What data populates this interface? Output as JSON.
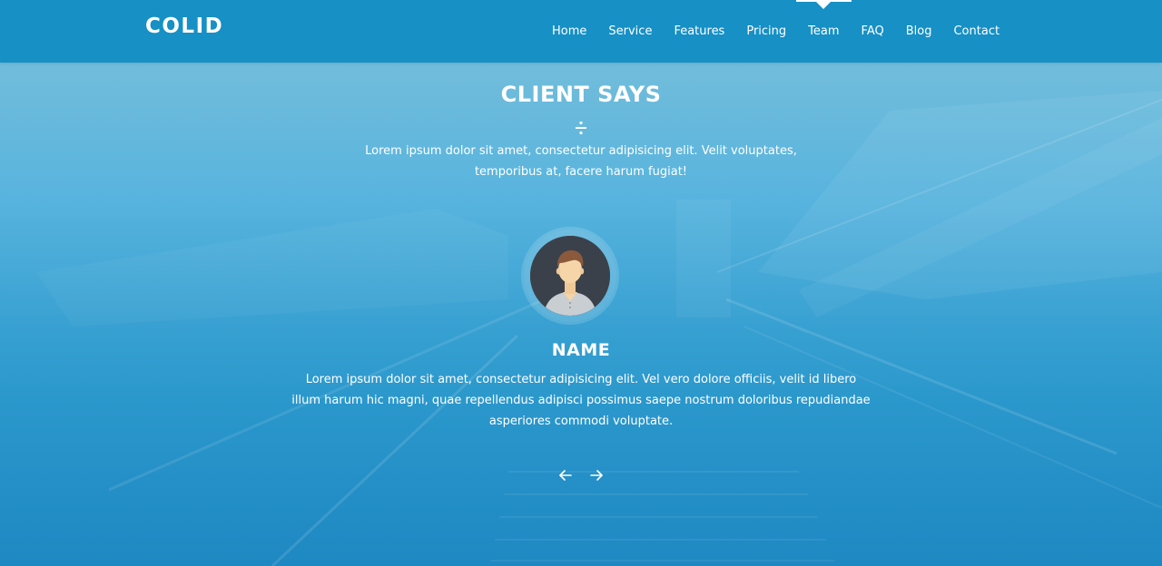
{
  "header": {
    "logo": "COLID",
    "nav": [
      {
        "label": "Home",
        "active": false
      },
      {
        "label": "Service",
        "active": false
      },
      {
        "label": "Features",
        "active": false
      },
      {
        "label": "Pricing",
        "active": false
      },
      {
        "label": "Team",
        "active": true
      },
      {
        "label": "FAQ",
        "active": false
      },
      {
        "label": "Blog",
        "active": false
      },
      {
        "label": "Contact",
        "active": false
      }
    ]
  },
  "section": {
    "title": "CLIENT SAYS",
    "divider_icon": "divide-icon",
    "subtitle": "Lorem ipsum dolor sit amet, consectetur adipisicing elit. Velit voluptates, temporibus at, facere harum fugiat!"
  },
  "testimonial": {
    "avatar_icon": "user-avatar-icon",
    "name": "NAME",
    "text": "Lorem ipsum dolor sit amet, consectetur adipisicing elit. Vel vero dolore officiis, velit id libero illum harum hic magni, quae repellendus adipisci possimus saepe nostrum doloribus repudiandae asperiores commodi voluptate."
  },
  "slider": {
    "prev_icon": "arrow-left-icon",
    "next_icon": "arrow-right-icon"
  },
  "colors": {
    "header_bg": "#1690c5",
    "section_bg_top": "#6bb8d6",
    "section_bg_bottom": "#1e88c2",
    "text": "#ffffff"
  }
}
